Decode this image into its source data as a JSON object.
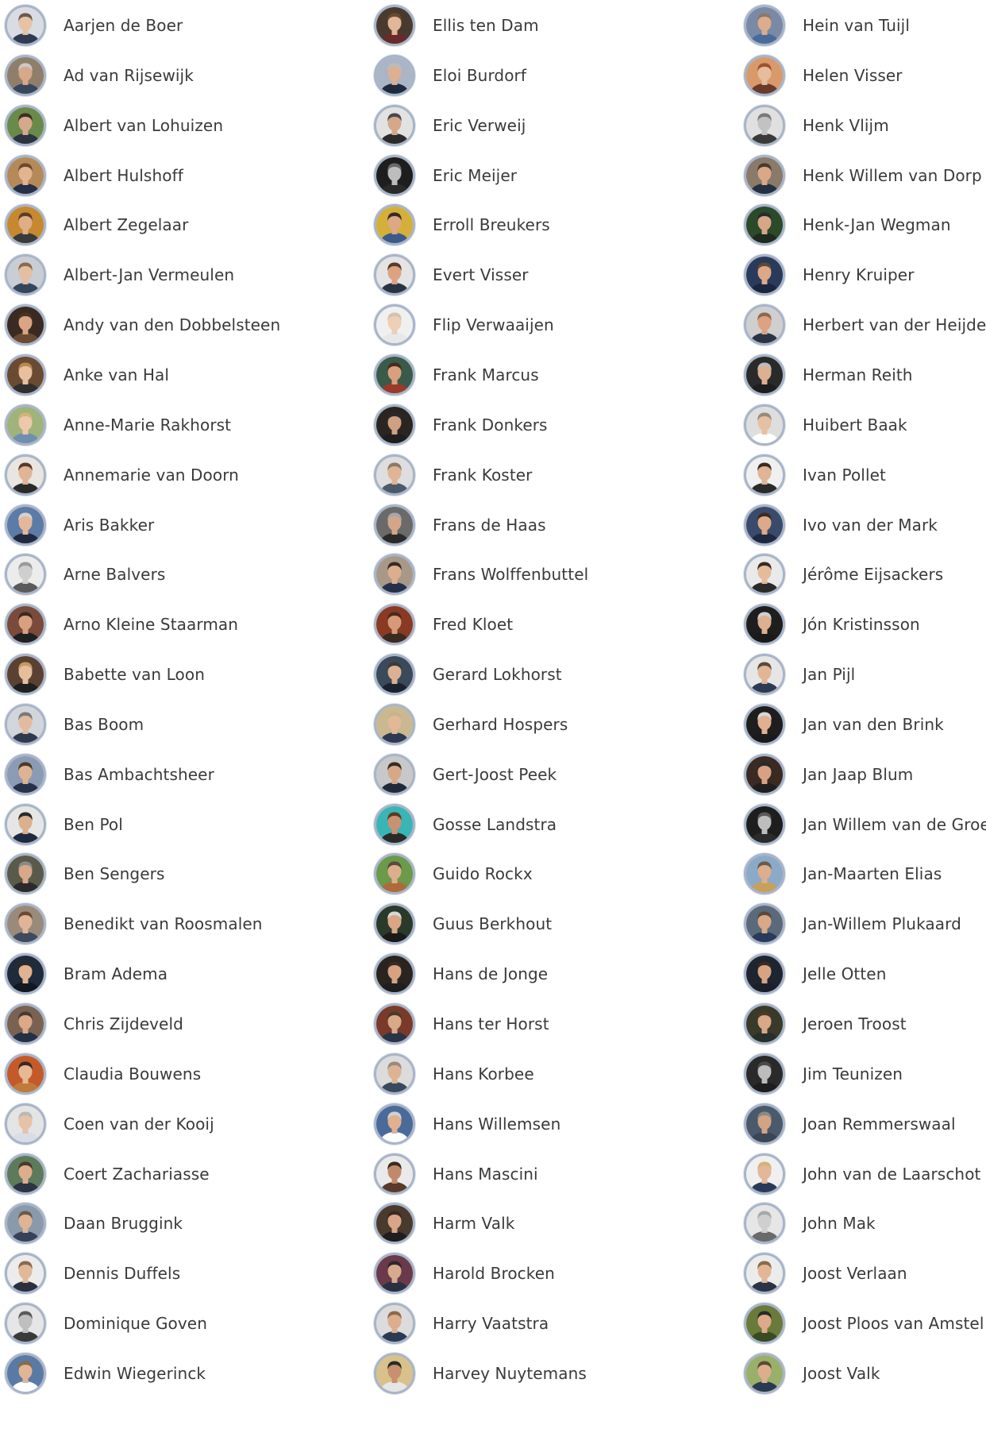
{
  "columns": [
    {
      "people": [
        {
          "name": "Aarjen de Boer",
          "avatar_bg": "#d9dde3",
          "skin": "#e6c3a5",
          "hair": "#6b5a4a",
          "shirt": "#2f3b52"
        },
        {
          "name": "Ad van Rijsewijk",
          "avatar_bg": "#8f7f6a",
          "skin": "#d9a789",
          "hair": "#c9c9c9",
          "shirt": "#38465c"
        },
        {
          "name": "Albert van Lohuizen",
          "avatar_bg": "#6a8a4a",
          "skin": "#d7a98c",
          "hair": "#3a3026",
          "shirt": "#2c3342"
        },
        {
          "name": "Albert Hulshoff",
          "avatar_bg": "#b58a58",
          "skin": "#e2b48f",
          "hair": "#6b4a2a",
          "shirt": "#233048"
        },
        {
          "name": "Albert Zegelaar",
          "avatar_bg": "#c6892f",
          "skin": "#dfae87",
          "hair": "#5a3e2a",
          "shirt": "#3a3a3a"
        },
        {
          "name": "Albert-Jan Vermeulen",
          "avatar_bg": "#c9cdd4",
          "skin": "#e4bea2",
          "hair": "#8a6a4a",
          "shirt": "#34465e"
        },
        {
          "name": "Andy van den Dobbelsteen",
          "avatar_bg": "#3a2a22",
          "skin": "#d9a583",
          "hair": "#4a3322",
          "shirt": "#6a4a32"
        },
        {
          "name": "Anke van Hal",
          "avatar_bg": "#6a4a32",
          "skin": "#e8c0a0",
          "hair": "#b88a52",
          "shirt": "#2f2f2f"
        },
        {
          "name": "Anne-Marie Rakhorst",
          "avatar_bg": "#9fb37a",
          "skin": "#ecc9ac",
          "hair": "#d4b37a",
          "shirt": "#6f8fb0"
        },
        {
          "name": "Annemarie van Doorn",
          "avatar_bg": "#e9e6e1",
          "skin": "#e0b596",
          "hair": "#5a3a2a",
          "shirt": "#2a2a2a"
        },
        {
          "name": "Aris Bakker",
          "avatar_bg": "#5c7ba6",
          "skin": "#e3b89a",
          "hair": "#d3d3d3",
          "shirt": "#1f2a40"
        },
        {
          "name": "Arne Balvers",
          "avatar_bg": "#ececec",
          "skin": "#cfcfcf",
          "hair": "#9a9a9a",
          "shirt": "#5a5a5a"
        },
        {
          "name": "Arno Kleine Staarman",
          "avatar_bg": "#7a4a3a",
          "skin": "#d9a080",
          "hair": "#3a2a22",
          "shirt": "#1f1f1f"
        },
        {
          "name": "Babette van Loon",
          "avatar_bg": "#5a4232",
          "skin": "#e6be9c",
          "hair": "#c49a62",
          "shirt": "#1f1f1f"
        },
        {
          "name": "Bas Boom",
          "avatar_bg": "#d2d6db",
          "skin": "#e2bb9e",
          "hair": "#7a7a7a",
          "shirt": "#2e3a4e"
        },
        {
          "name": "Bas Ambachtsheer",
          "avatar_bg": "#8b9bb3",
          "skin": "#ddb393",
          "hair": "#4a3a2a",
          "shirt": "#26324a"
        },
        {
          "name": "Ben Pol",
          "avatar_bg": "#e6e6e6",
          "skin": "#dcb08e",
          "hair": "#2a2a2a",
          "shirt": "#1e2a3e"
        },
        {
          "name": "Ben Sengers",
          "avatar_bg": "#5a5a4a",
          "skin": "#d8a988",
          "hair": "#8a8a8a",
          "shirt": "#2a2a2a"
        },
        {
          "name": "Benedikt van Roosmalen",
          "avatar_bg": "#9a8a7a",
          "skin": "#dfb595",
          "hair": "#6a4a32",
          "shirt": "#3e4a5e"
        },
        {
          "name": "Bram Adema",
          "avatar_bg": "#1f2a3a",
          "skin": "#e0b292",
          "hair": "#2a2a2a",
          "shirt": "#111822"
        },
        {
          "name": "Chris Zijdeveld",
          "avatar_bg": "#7a6252",
          "skin": "#dba888",
          "hair": "#4a3a2e",
          "shirt": "#243046"
        },
        {
          "name": "Claudia Bouwens",
          "avatar_bg": "#c45a2a",
          "skin": "#e6b896",
          "hair": "#3a2a22",
          "shirt": "#c27a3a"
        },
        {
          "name": "Coen van der Kooij",
          "avatar_bg": "#e4e4e4",
          "skin": "#e6c2a6",
          "hair": "#b9b9b9",
          "shirt": "#d8dde6"
        },
        {
          "name": "Coert Zachariasse",
          "avatar_bg": "#5d7a5a",
          "skin": "#dcae8e",
          "hair": "#4a3a2a",
          "shirt": "#2b3344"
        },
        {
          "name": "Daan Bruggink",
          "avatar_bg": "#8a9aaa",
          "skin": "#deb494",
          "hair": "#6a5a4a",
          "shirt": "#364258"
        },
        {
          "name": "Dennis Duffels",
          "avatar_bg": "#ececec",
          "skin": "#e1b898",
          "hair": "#8a6a4a",
          "shirt": "#2a3040"
        },
        {
          "name": "Dominique Goven",
          "avatar_bg": "#e6e6e6",
          "skin": "#bfbfbf",
          "hair": "#5a5a5a",
          "shirt": "#3a3a3a"
        },
        {
          "name": "Edwin Wiegerinck",
          "avatar_bg": "#5a7aa6",
          "skin": "#e0b696",
          "hair": "#8a6a4a",
          "shirt": "#ffffff"
        }
      ]
    },
    {
      "people": [
        {
          "name": "Ellis ten Dam",
          "avatar_bg": "#4a3a2e",
          "skin": "#e2b698",
          "hair": "#6a4a2e",
          "shirt": "#6a2a2a"
        },
        {
          "name": "Eloi Burdorf",
          "avatar_bg": "#aab5c5",
          "skin": "#dcb090",
          "hair": "#bcbcbc",
          "shirt": "#1f2a3e"
        },
        {
          "name": "Eric Verweij",
          "avatar_bg": "#e2e2e2",
          "skin": "#d6a88a",
          "hair": "#4a4a4a",
          "shirt": "#2b2b2b"
        },
        {
          "name": "Eric Meijer",
          "avatar_bg": "#1e1e1e",
          "skin": "#bdbdbd",
          "hair": "#6a6a6a",
          "shirt": "#2a2a2a"
        },
        {
          "name": "Erroll Breukers",
          "avatar_bg": "#d4b03a",
          "skin": "#dba888",
          "hair": "#3a2a22",
          "shirt": "#3a5a8a"
        },
        {
          "name": "Evert Visser",
          "avatar_bg": "#e4e4e4",
          "skin": "#dca282",
          "hair": "#5a3a2a",
          "shirt": "#2a3344"
        },
        {
          "name": "Flip Verwaaijen",
          "avatar_bg": "#f0f0f0",
          "skin": "#eecfb6",
          "hair": "#d2c2b2",
          "shirt": "#e8e8e8"
        },
        {
          "name": "Frank Marcus",
          "avatar_bg": "#3a5a4a",
          "skin": "#d9a080",
          "hair": "#4a2a1e",
          "shirt": "#9a3a2a"
        },
        {
          "name": "Frank Donkers",
          "avatar_bg": "#2a2520",
          "skin": "#cfa082",
          "hair": "#2a2a2a",
          "shirt": "#1e1e1e"
        },
        {
          "name": "Frank Koster",
          "avatar_bg": "#dedede",
          "skin": "#e0b494",
          "hair": "#8a7a6a",
          "shirt": "#4a5a6a"
        },
        {
          "name": "Frans de Haas",
          "avatar_bg": "#6a6a6a",
          "skin": "#d4a688",
          "hair": "#a8a8a8",
          "shirt": "#2a2a2a"
        },
        {
          "name": "Frans Wolffenbuttel",
          "avatar_bg": "#a89888",
          "skin": "#dcae8e",
          "hair": "#3a2a22",
          "shirt": "#24304a"
        },
        {
          "name": "Fred Kloet",
          "avatar_bg": "#8a3a22",
          "skin": "#d69a78",
          "hair": "#4a2a1e",
          "shirt": "#3a2a22"
        },
        {
          "name": "Gerard Lokhorst",
          "avatar_bg": "#3a4a5a",
          "skin": "#dcb092",
          "hair": "#3a3a3a",
          "shirt": "#1a2230"
        },
        {
          "name": "Gerhard Hospers",
          "avatar_bg": "#c9b890",
          "skin": "#e2b898",
          "hair": "#c9b48a",
          "shirt": "#2c3a52"
        },
        {
          "name": "Gert-Joost Peek",
          "avatar_bg": "#c8c8c8",
          "skin": "#d6a888",
          "hair": "#3a2a22",
          "shirt": "#202a3a"
        },
        {
          "name": "Gosse Landstra",
          "avatar_bg": "#3ab5b5",
          "skin": "#c89272",
          "hair": "#5a3a22",
          "shirt": "#2a2a2a"
        },
        {
          "name": "Guido Rockx",
          "avatar_bg": "#6a9a4a",
          "skin": "#dcae8c",
          "hair": "#5a4a3a",
          "shirt": "#b06a3a"
        },
        {
          "name": "Guus Berkhout",
          "avatar_bg": "#2a3a2a",
          "skin": "#d9a686",
          "hair": "#d8d8d8",
          "shirt": "#1a1a1a"
        },
        {
          "name": "Hans de Jonge",
          "avatar_bg": "#2a2420",
          "skin": "#d6a282",
          "hair": "#3a2a22",
          "shirt": "#1e1e1e"
        },
        {
          "name": "Hans ter Horst",
          "avatar_bg": "#7a3a2a",
          "skin": "#d9aa8a",
          "hair": "#4a3a2a",
          "shirt": "#2a3446"
        },
        {
          "name": "Hans Korbee",
          "avatar_bg": "#dcdcdc",
          "skin": "#dcb494",
          "hair": "#9a8a7a",
          "shirt": "#3a4a5e"
        },
        {
          "name": "Hans Willemsen",
          "avatar_bg": "#4a6a9a",
          "skin": "#e0b090",
          "hair": "#d0d0d0",
          "shirt": "#ffffff"
        },
        {
          "name": "Hans Mascini",
          "avatar_bg": "#eaeaea",
          "skin": "#c08a6a",
          "hair": "#3a2a22",
          "shirt": "#5a3a2a"
        },
        {
          "name": "Harm Valk",
          "avatar_bg": "#4a3a2e",
          "skin": "#d8a686",
          "hair": "#3a2a22",
          "shirt": "#1e1e1e"
        },
        {
          "name": "Harold Brocken",
          "avatar_bg": "#6a3a4a",
          "skin": "#d8aa8c",
          "hair": "#2a2a2a",
          "shirt": "#2a3042"
        },
        {
          "name": "Harry Vaatstra",
          "avatar_bg": "#dcdcdc",
          "skin": "#dcae8e",
          "hair": "#8a6a4a",
          "shirt": "#2a3a52"
        },
        {
          "name": "Harvey Nuytemans",
          "avatar_bg": "#d8c28a",
          "skin": "#c89070",
          "hair": "#2a2a2a",
          "shirt": "#e6e6e6"
        }
      ]
    },
    {
      "people": [
        {
          "name": "Hein van Tuijl",
          "avatar_bg": "#7a8aa6",
          "skin": "#dcac8c",
          "hair": "#8a7a6a",
          "shirt": "#4a6a9a"
        },
        {
          "name": "Helen Visser",
          "avatar_bg": "#d89a6a",
          "skin": "#e6bc9c",
          "hair": "#a0522d",
          "shirt": "#6a3a2a"
        },
        {
          "name": "Henk Vlijm",
          "avatar_bg": "#e0e0e0",
          "skin": "#c2c2c2",
          "hair": "#7a7a7a",
          "shirt": "#3a3a3a"
        },
        {
          "name": "Henk Willem van Dorp",
          "avatar_bg": "#8a7a6a",
          "skin": "#d8a888",
          "hair": "#4a3a2a",
          "shirt": "#243042"
        },
        {
          "name": "Henk-Jan Wegman",
          "avatar_bg": "#2a4a2a",
          "skin": "#d6a686",
          "hair": "#2a2a2a",
          "shirt": "#1e2a1e"
        },
        {
          "name": "Henry Kruiper",
          "avatar_bg": "#2a3a5a",
          "skin": "#dca888",
          "hair": "#5a4a3a",
          "shirt": "#1a2640"
        },
        {
          "name": "Herbert van der Heijden",
          "avatar_bg": "#cfcfcf",
          "skin": "#dca282",
          "hair": "#8a6a4a",
          "shirt": "#2a3446"
        },
        {
          "name": "Herman Reith",
          "avatar_bg": "#2a2a2a",
          "skin": "#dcb090",
          "hair": "#bcbcbc",
          "shirt": "#1e1e1e"
        },
        {
          "name": "Huibert Baak",
          "avatar_bg": "#dedede",
          "skin": "#e6c0a2",
          "hair": "#9a8a7a",
          "shirt": "#ffffff"
        },
        {
          "name": "Ivan Pollet",
          "avatar_bg": "#f0f0f0",
          "skin": "#e0b494",
          "hair": "#3a2a22",
          "shirt": "#2a2a2a"
        },
        {
          "name": "Ivo van der Mark",
          "avatar_bg": "#3a4a6a",
          "skin": "#dcaa8a",
          "hair": "#3a2a22",
          "shirt": "#1e2840"
        },
        {
          "name": "Jérôme Eijsackers",
          "avatar_bg": "#eaeaea",
          "skin": "#e4bc9c",
          "hair": "#3a2a22",
          "shirt": "#2a2a2a"
        },
        {
          "name": "Jón Kristinsson",
          "avatar_bg": "#1e1e1e",
          "skin": "#dcb090",
          "hair": "#cfcfcf",
          "shirt": "#1a1a1a"
        },
        {
          "name": "Jan Pijl",
          "avatar_bg": "#e6e6e6",
          "skin": "#e0b696",
          "hair": "#5a4a3a",
          "shirt": "#2c3a52"
        },
        {
          "name": "Jan van den Brink",
          "avatar_bg": "#1e1e1e",
          "skin": "#e0b090",
          "hair": "#d8d8d8",
          "shirt": "#1a1a1a"
        },
        {
          "name": "Jan Jaap Blum",
          "avatar_bg": "#3a2a22",
          "skin": "#d8a282",
          "hair": "#2a2a2a",
          "shirt": "#1e1e1e"
        },
        {
          "name": "Jan Willem van de Groep",
          "avatar_bg": "#1e1e1e",
          "skin": "#bdbdbd",
          "hair": "#5a5a5a",
          "shirt": "#2a2a2a"
        },
        {
          "name": "Jan-Maarten Elias",
          "avatar_bg": "#8aaac8",
          "skin": "#dcae8e",
          "hair": "#6a5a4a",
          "shirt": "#c8a05a"
        },
        {
          "name": "Jan-Willem Plukaard",
          "avatar_bg": "#5a6a7a",
          "skin": "#d8a888",
          "hair": "#5a4a3a",
          "shirt": "#2a3a5a"
        },
        {
          "name": "Jelle Otten",
          "avatar_bg": "#1e2430",
          "skin": "#d6a484",
          "hair": "#3a2a22",
          "shirt": "#1a1f2a"
        },
        {
          "name": "Jeroen Troost",
          "avatar_bg": "#3a3a2a",
          "skin": "#d8a888",
          "hair": "#4a3a2a",
          "shirt": "#26302a"
        },
        {
          "name": "Jim Teunizen",
          "avatar_bg": "#2a2a2a",
          "skin": "#bcbcbc",
          "hair": "#4a4a4a",
          "shirt": "#1e1e1e"
        },
        {
          "name": "Joan Remmerswaal",
          "avatar_bg": "#4a5a6a",
          "skin": "#d2a484",
          "hair": "#8a8a8a",
          "shirt": "#3a4656"
        },
        {
          "name": "John van de Laarschot",
          "avatar_bg": "#f0f0f0",
          "skin": "#e2b898",
          "hair": "#d4b27a",
          "shirt": "#2a3a5a"
        },
        {
          "name": "John Mak",
          "avatar_bg": "#e6e6e6",
          "skin": "#cfcfcf",
          "hair": "#a8a8a8",
          "shirt": "#6a6a6a"
        },
        {
          "name": "Joost Verlaan",
          "avatar_bg": "#ececec",
          "skin": "#e2b696",
          "hair": "#8a6a4a",
          "shirt": "#2a3446"
        },
        {
          "name": "Joost Ploos van Amstel",
          "avatar_bg": "#6a7a3a",
          "skin": "#dcaa8a",
          "hair": "#2a2a2a",
          "shirt": "#3a4a22"
        },
        {
          "name": "Joost Valk",
          "avatar_bg": "#9ab06a",
          "skin": "#dcae8e",
          "hair": "#5a4a3a",
          "shirt": "#2a3a52"
        }
      ]
    }
  ]
}
